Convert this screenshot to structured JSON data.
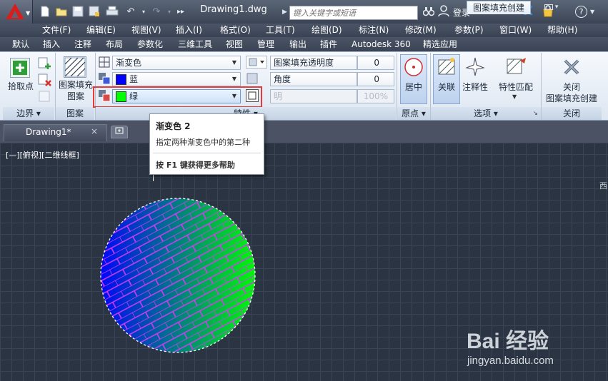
{
  "titlebar": {
    "doc_title": "Drawing1.dwg",
    "search_placeholder": "键入关键字或短语",
    "signin_label": "登录",
    "help_label": "?"
  },
  "menubar": {
    "items": [
      "文件(F)",
      "编辑(E)",
      "视图(V)",
      "插入(I)",
      "格式(O)",
      "工具(T)",
      "绘图(D)",
      "标注(N)",
      "修改(M)",
      "参数(P)",
      "窗口(W)",
      "帮助(H)"
    ]
  },
  "ribbon_tabs": {
    "items": [
      "默认",
      "插入",
      "注释",
      "布局",
      "参数化",
      "三维工具",
      "视图",
      "管理",
      "输出",
      "插件",
      "Autodesk 360",
      "精选应用"
    ],
    "active": "图案填充创建"
  },
  "ribbon": {
    "boundary": {
      "pick_points_label": "拾取点",
      "panel_title": "边界"
    },
    "pattern": {
      "button_label_line1": "图案填充",
      "button_label_line2": "图案",
      "panel_title": "图案"
    },
    "properties": {
      "hatch_type": "渐变色",
      "color1_name": "蓝",
      "color1_hex": "#0000ff",
      "color2_name": "绿",
      "color2_hex": "#00ff00",
      "transparency_label": "图案填充透明度",
      "transparency_value": "0",
      "angle_label": "角度",
      "angle_value": "0",
      "tint_label": "明",
      "tint_value": "100%",
      "panel_title": "特性"
    },
    "origin": {
      "center_label": "居中",
      "panel_title": "原点"
    },
    "options": {
      "associative_label": "关联",
      "annotative_label": "注释性",
      "match_label": "特性匹配",
      "panel_title": "选项"
    },
    "close": {
      "label_line1": "关闭",
      "label_line2": "图案填充创建",
      "panel_title": "关闭"
    }
  },
  "doc_tab": {
    "label": "Drawing1*",
    "close": "×"
  },
  "viewport": {
    "label": "[—][俯视][二维线框]",
    "viewcube_text": "西"
  },
  "tooltip": {
    "title": "渐变色 2",
    "description": "指定两种渐变色中的第二种",
    "help": "按 F1 键获得更多帮助"
  },
  "hatch": {
    "gradient_from": "#0000ff",
    "gradient_to": "#00ff00",
    "brick_line_color": "#d23cf0"
  },
  "watermark": {
    "main": "Bai 经验",
    "sub": "jingyan.baidu.com"
  },
  "colors": {
    "highlight_box": "#e53a3a",
    "accent_blue": "#3d7fd8"
  }
}
